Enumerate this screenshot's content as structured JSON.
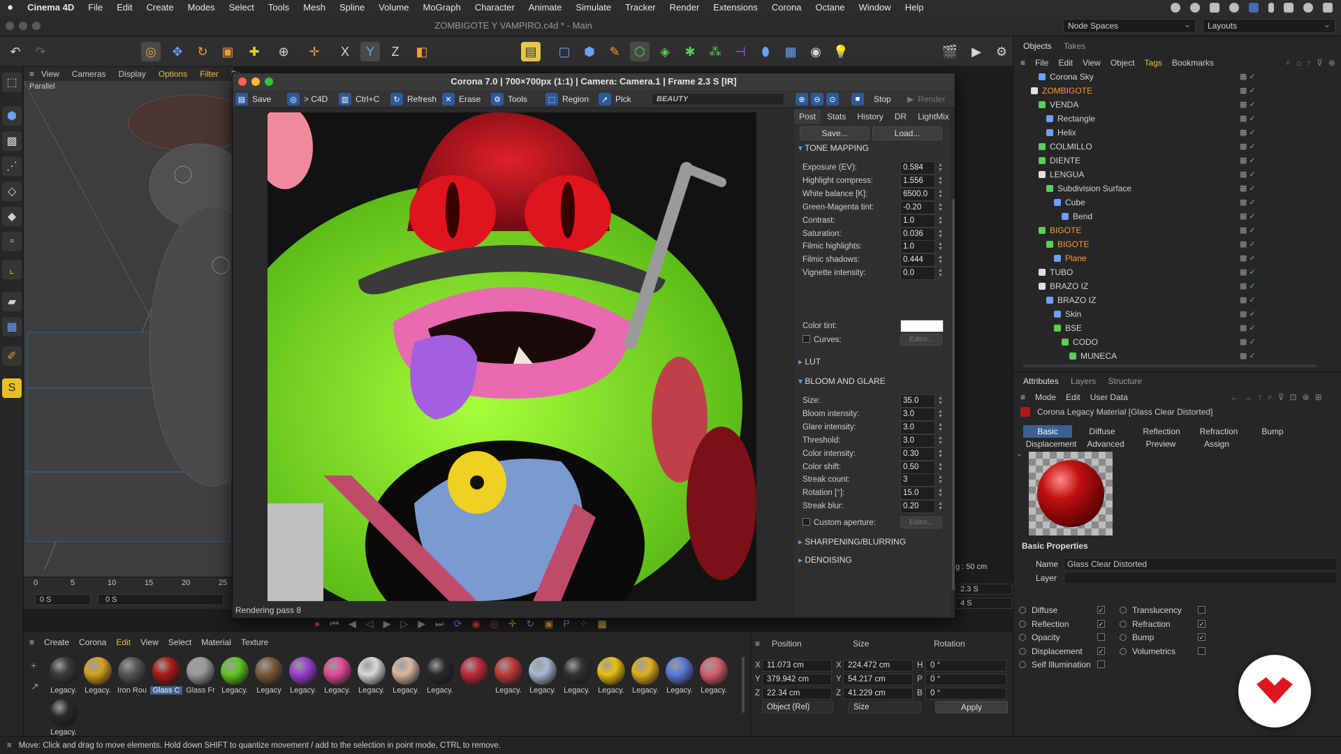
{
  "macmenu": {
    "app": "Cinema 4D",
    "items": [
      "File",
      "Edit",
      "Create",
      "Modes",
      "Select",
      "Tools",
      "Mesh",
      "Spline",
      "Volume",
      "MoGraph",
      "Character",
      "Animate",
      "Simulate",
      "Tracker",
      "Render",
      "Extensions",
      "Corona",
      "Octane",
      "Window",
      "Help"
    ]
  },
  "window": {
    "title": "ZOMBIGOTE Y VAMPIRO.c4d * - Main",
    "node_spaces": "Node Spaces",
    "layouts": "Layouts"
  },
  "viewport": {
    "menu": [
      "View",
      "Cameras",
      "Display",
      "Options",
      "Filter",
      "Pa"
    ],
    "camera_label": "Parallel",
    "timeline_ticks": [
      "0",
      "5",
      "10",
      "15",
      "20",
      "25"
    ],
    "time_start": "0 S",
    "time_current": "0 S",
    "grid_spacing": "g : 50 cm",
    "time_right1": "2.3 S",
    "time_right2": "4 S"
  },
  "vfb": {
    "title": "Corona 7.0 | 700×700px (1:1) | Camera: Camera.1 | Frame 2.3 S [IR]",
    "toolbar": {
      "save": "Save",
      "to_c4d": "> C4D",
      "copy": "Ctrl+C",
      "refresh": "Refresh",
      "erase": "Erase",
      "tools": "Tools",
      "region": "Region",
      "pick": "Pick",
      "channel": "BEAUTY",
      "stop": "Stop",
      "render": "Render"
    },
    "status": "Rendering pass 8",
    "post": {
      "tabs": [
        "Post",
        "Stats",
        "History",
        "DR",
        "LightMix"
      ],
      "save": "Save...",
      "load": "Load...",
      "tone_mapping": {
        "title": "TONE MAPPING",
        "rows": [
          {
            "label": "Exposure (EV):",
            "value": "0.584"
          },
          {
            "label": "Highlight compress:",
            "value": "1.556"
          },
          {
            "label": "White balance [K]:",
            "value": "6500.0"
          },
          {
            "label": "Green-Magenta tint:",
            "value": "-0.20"
          },
          {
            "label": "Contrast:",
            "value": "1.0"
          },
          {
            "label": "Saturation:",
            "value": "0.036"
          },
          {
            "label": "Filmic highlights:",
            "value": "1.0"
          },
          {
            "label": "Filmic shadows:",
            "value": "0.444"
          },
          {
            "label": "Vignette intensity:",
            "value": "0.0"
          }
        ],
        "color_tint": "Color tint:",
        "curves": "Curves:",
        "editor": "Editor..."
      },
      "lut": "LUT",
      "bloom": {
        "title": "BLOOM AND GLARE",
        "rows": [
          {
            "label": "Size:",
            "value": "35.0"
          },
          {
            "label": "Bloom intensity:",
            "value": "3.0"
          },
          {
            "label": "Glare intensity:",
            "value": "3.0"
          },
          {
            "label": "Threshold:",
            "value": "3.0"
          },
          {
            "label": "Color intensity:",
            "value": "0.30"
          },
          {
            "label": "Color shift:",
            "value": "0.50"
          },
          {
            "label": "Streak count:",
            "value": "3"
          },
          {
            "label": "Rotation [°]:",
            "value": "15.0"
          },
          {
            "label": "Streak blur:",
            "value": "0.20"
          }
        ],
        "custom_aperture": "Custom aperture:",
        "editor": "Editor..."
      },
      "sharpening": "SHARPENING/BLURRING",
      "denoising": "DENOISING"
    }
  },
  "objects": {
    "tabs": [
      "Objects",
      "Takes"
    ],
    "menu": [
      "File",
      "Edit",
      "View",
      "Object",
      "Tags",
      "Bookmarks"
    ],
    "rows": [
      {
        "name": "Corona Sky",
        "indent": 2,
        "color": "#d4d4d4",
        "icon": "#6aa0ff"
      },
      {
        "name": "ZOMBIGOTE",
        "indent": 1,
        "color": "#ff9a2e",
        "icon": "#e0e0e0"
      },
      {
        "name": "VENDA",
        "indent": 2,
        "color": "#d4d4d4",
        "icon": "#58d058"
      },
      {
        "name": "Rectangle",
        "indent": 3,
        "color": "#d4d4d4",
        "icon": "#6aa0ff"
      },
      {
        "name": "Helix",
        "indent": 3,
        "color": "#d4d4d4",
        "icon": "#6aa0ff"
      },
      {
        "name": "COLMILLO",
        "indent": 2,
        "color": "#d4d4d4",
        "icon": "#58d058"
      },
      {
        "name": "DIENTE",
        "indent": 2,
        "color": "#d4d4d4",
        "icon": "#58d058"
      },
      {
        "name": "LENGUA",
        "indent": 2,
        "color": "#d4d4d4",
        "icon": "#e0e0e0"
      },
      {
        "name": "Subdivision Surface",
        "indent": 3,
        "color": "#d4d4d4",
        "icon": "#58d058"
      },
      {
        "name": "Cube",
        "indent": 4,
        "color": "#d4d4d4",
        "icon": "#6aa0ff"
      },
      {
        "name": "Bend",
        "indent": 5,
        "color": "#d4d4d4",
        "icon": "#6aa0ff"
      },
      {
        "name": "BIGOTE",
        "indent": 2,
        "color": "#ff9a2e",
        "icon": "#58d058"
      },
      {
        "name": "BIGOTE",
        "indent": 3,
        "color": "#ff9a2e",
        "icon": "#58d058"
      },
      {
        "name": "Plane",
        "indent": 4,
        "color": "#ff9a2e",
        "icon": "#6aa0ff"
      },
      {
        "name": "TUBO",
        "indent": 2,
        "color": "#d4d4d4",
        "icon": "#e0e0e0"
      },
      {
        "name": "BRAZO IZ",
        "indent": 2,
        "color": "#d4d4d4",
        "icon": "#e0e0e0"
      },
      {
        "name": "BRAZO IZ",
        "indent": 3,
        "color": "#d4d4d4",
        "icon": "#6aa0ff"
      },
      {
        "name": "Skin",
        "indent": 4,
        "color": "#d4d4d4",
        "icon": "#6aa0ff"
      },
      {
        "name": "BSE",
        "indent": 4,
        "color": "#d4d4d4",
        "icon": "#58d058"
      },
      {
        "name": "CODO",
        "indent": 5,
        "color": "#d4d4d4",
        "icon": "#58d058"
      },
      {
        "name": "MUNECA",
        "indent": 6,
        "color": "#d4d4d4",
        "icon": "#58d058"
      }
    ]
  },
  "attributes": {
    "tabs": [
      "Attributes",
      "Layers",
      "Structure"
    ],
    "menu": [
      "Mode",
      "Edit",
      "User Data"
    ],
    "object_title": "Corona Legacy Material [Glass Clear Distorted]",
    "subtabs_row1": [
      "Basic",
      "Diffuse",
      "Reflection",
      "Refraction",
      "Bump"
    ],
    "subtabs_row2": [
      "Displacement",
      "Advanced",
      "Preview",
      "Assign"
    ],
    "section": "Basic Properties",
    "name_label": "Name",
    "name_value": "Glass Clear Distorted",
    "layer_label": "Layer",
    "left_checks": [
      {
        "label": "Diffuse",
        "checked": true
      },
      {
        "label": "Reflection",
        "checked": true
      },
      {
        "label": "Opacity",
        "checked": false
      },
      {
        "label": "Displacement",
        "checked": true
      },
      {
        "label": "Self Illumination",
        "checked": false
      }
    ],
    "right_checks": [
      {
        "label": "Translucency",
        "checked": false
      },
      {
        "label": "Refraction",
        "checked": true
      },
      {
        "label": "Bump",
        "checked": true
      },
      {
        "label": "Volumetrics",
        "checked": false
      }
    ]
  },
  "materials": {
    "menu": [
      "Create",
      "Corona",
      "Edit",
      "View",
      "Select",
      "Material",
      "Texture"
    ],
    "items": [
      {
        "label": "Legacy.",
        "color": "#3a3a3a"
      },
      {
        "label": "Legacy.",
        "color": "#d4a020"
      },
      {
        "label": "Iron Rou",
        "color": "#555555"
      },
      {
        "label": "Glass C",
        "color": "#b01818",
        "selected": true
      },
      {
        "label": "Glass Fr",
        "color": "#9a9a9a"
      },
      {
        "label": "Legacy.",
        "color": "#5ec820"
      },
      {
        "label": "Legacy",
        "color": "#7a5a3a"
      },
      {
        "label": "Legacy.",
        "color": "#9a40d0"
      },
      {
        "label": "Legacy.",
        "color": "#e04a9a"
      },
      {
        "label": "Legacy.",
        "color": "#d8d8d8"
      },
      {
        "label": "Legacy.",
        "color": "#d8b8a0"
      },
      {
        "label": "Legacy.",
        "color": "#2a2a2a"
      },
      {
        "label": "",
        "color": "#c02a3a"
      },
      {
        "label": "Legacy.",
        "color": "#c03a3a"
      },
      {
        "label": "Legacy.",
        "color": "#a8b8d8"
      },
      {
        "label": "Legacy.",
        "color": "#333333"
      },
      {
        "label": "Legacy.",
        "color": "#e8c010"
      },
      {
        "label": "Legacy.",
        "color": "#e0b020"
      },
      {
        "label": "Legacy.",
        "color": "#5a7ad8"
      },
      {
        "label": "Legacy.",
        "color": "#d86070"
      },
      {
        "label": "Legacy.",
        "color": "#2a2a2a"
      }
    ]
  },
  "coordinates": {
    "headers": [
      "Position",
      "Size",
      "Rotation"
    ],
    "rows": [
      {
        "axis": "X",
        "pos": "11.073 cm",
        "saxis": "X",
        "size": "224.472 cm",
        "raxis": "H",
        "rot": "0 °"
      },
      {
        "axis": "Y",
        "pos": "379.942 cm",
        "saxis": "Y",
        "size": "54.217 cm",
        "raxis": "P",
        "rot": "0 °"
      },
      {
        "axis": "Z",
        "pos": "22.34 cm",
        "saxis": "Z",
        "size": "41.229 cm",
        "raxis": "B",
        "rot": "0 °"
      }
    ],
    "mode": "Object (Rel)",
    "size_mode": "Size",
    "apply": "Apply"
  },
  "status": "Move: Click and drag to move elements. Hold down SHIFT to quantize movement / add to the selection in point mode, CTRL to remove.",
  "colors": {
    "accent": "#3e5f94",
    "orange": "#ff9a2e",
    "badge": "#e0161e"
  }
}
